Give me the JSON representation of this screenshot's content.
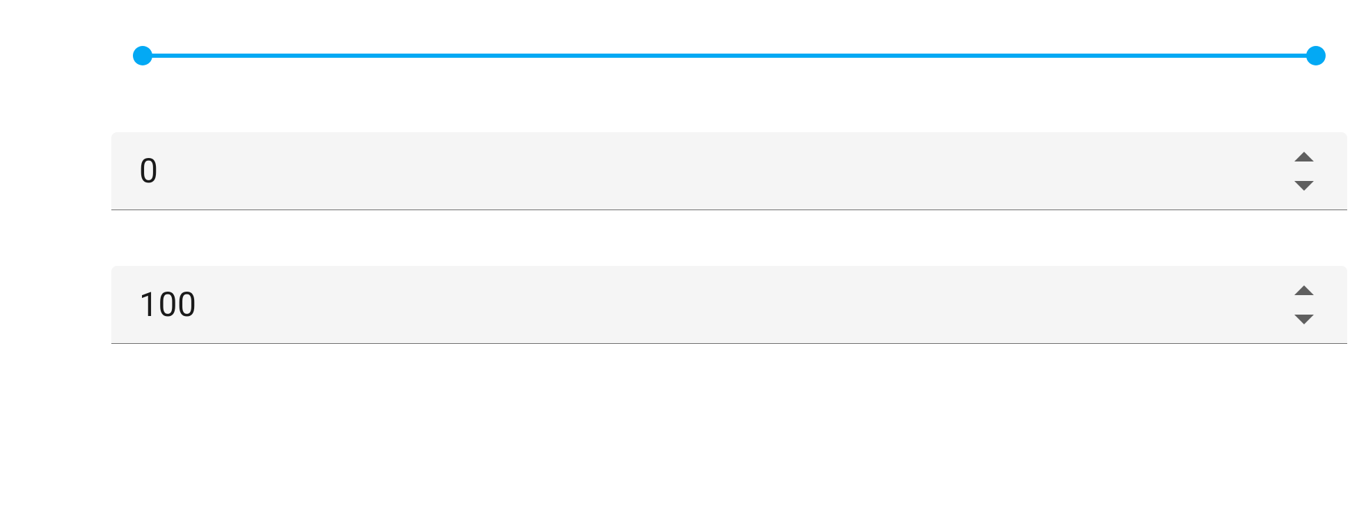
{
  "slider": {
    "min_value": 0,
    "max_value": 100,
    "accent_color": "#03A9F4"
  },
  "inputs": {
    "min_input_value": "0",
    "max_input_value": "100"
  }
}
